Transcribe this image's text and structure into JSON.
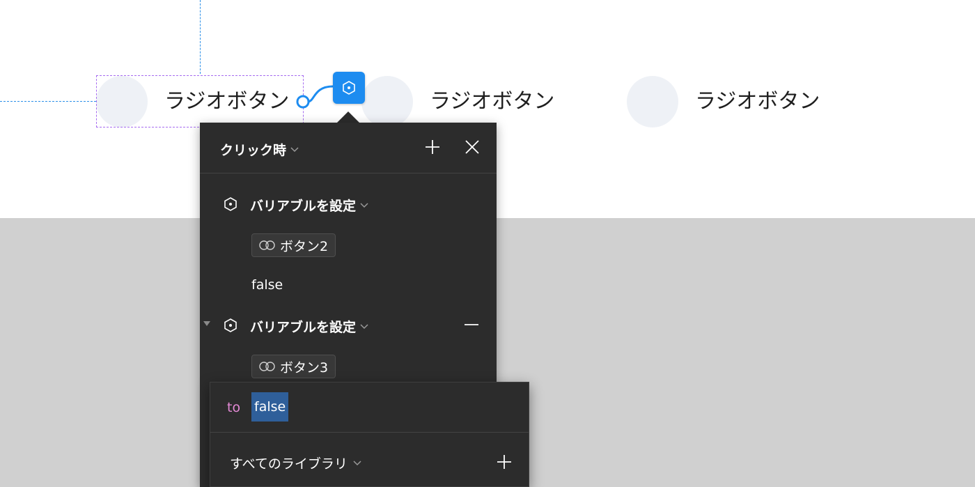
{
  "canvas": {
    "radio_items": [
      {
        "label": "ラジオボタン"
      },
      {
        "label": "ラジオボタン"
      },
      {
        "label": "ラジオボタン"
      }
    ],
    "colors": {
      "guide": "#2a8fe8",
      "selection": "#a66bf0",
      "node": "#1d8cf0",
      "canvas_bg": "#d0d0d0"
    }
  },
  "interaction_panel": {
    "trigger_label": "クリック時",
    "icons": {
      "add": "plus-icon",
      "close": "close-icon",
      "trigger_dropdown": "chevron-down-icon"
    },
    "actions": [
      {
        "label": "バリアブルを設定",
        "variable": "ボタン2",
        "value": "false"
      },
      {
        "label": "バリアブルを設定",
        "variable": "ボタン3"
      }
    ]
  },
  "value_popup": {
    "prefix": "to",
    "value": "false",
    "library_label": "すべてのライブラリ",
    "colors": {
      "prefix": "#e58ad6",
      "selection": "#2f5f9a"
    }
  }
}
